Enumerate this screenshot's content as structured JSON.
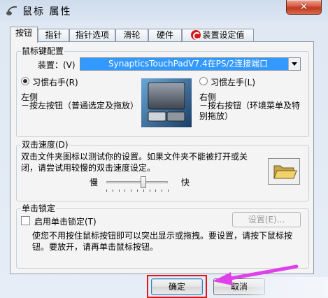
{
  "window": {
    "title": "鼠标 属性",
    "close_label": "✕"
  },
  "tabs": [
    {
      "label": "按钮",
      "active": true
    },
    {
      "label": "指针",
      "active": false
    },
    {
      "label": "指针选项",
      "active": false
    },
    {
      "label": "滑轮",
      "active": false
    },
    {
      "label": "硬件",
      "active": false
    },
    {
      "label": "装置设定值",
      "active": false,
      "icon": "synaptics-icon"
    }
  ],
  "button_config": {
    "group_label": "鼠标键配置",
    "device_label": "装置：(V)",
    "device_value": "SynapticsTouchPadV7.4在PS/2连接端口",
    "right_hand_label": "习惯右手(R)",
    "left_hand_label": "习惯左手(L)",
    "selected": "right",
    "left_side_title": "左侧",
    "left_side_desc": "－按左按钮（普通选定及拖放）",
    "right_side_title": "右侧",
    "right_side_desc": "－按右按钮（环境菜单及特别拖放）"
  },
  "double_click": {
    "group_label": "双击速度(D)",
    "description": "双击文件夹图标以测试你的设置。如果文件夹不能被打开或关闭，请尝试用较慢的双击速度设定。",
    "slow_label": "慢",
    "fast_label": "快",
    "speed_fraction": 0.6,
    "icon": "folder-icon"
  },
  "click_lock": {
    "group_label": "单击锁定",
    "checkbox_label": "启用单击锁定(T)",
    "checked": false,
    "settings_label": "设置(E)...",
    "description": "使您不用按住鼠标按钮即可以突出显示或拖拽。要设置，请按下鼠标按钮。要放开，请再单击鼠标按钮。"
  },
  "footer": {
    "ok_label": "确定",
    "cancel_label": "取消"
  },
  "annotation": {
    "arrow_color": "#e040e8",
    "frame_color": "#e8141c"
  }
}
